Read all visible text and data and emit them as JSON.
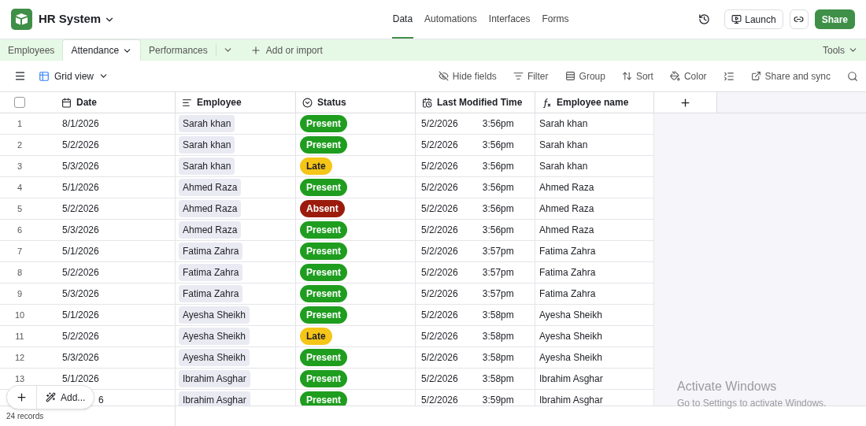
{
  "app": {
    "title": "HR System"
  },
  "nav": [
    {
      "label": "Data",
      "selected": true
    },
    {
      "label": "Automations",
      "selected": false
    },
    {
      "label": "Interfaces",
      "selected": false
    },
    {
      "label": "Forms",
      "selected": false
    }
  ],
  "header_actions": {
    "launch": "Launch",
    "share": "Share"
  },
  "tables": [
    {
      "label": "Employees",
      "selected": false
    },
    {
      "label": "Attendance",
      "selected": true
    },
    {
      "label": "Performances",
      "selected": false
    }
  ],
  "add_table": "Add or import",
  "tools": "Tools",
  "view": {
    "name": "Grid view"
  },
  "toolbar": [
    {
      "kind": "hide",
      "label": "Hide fields"
    },
    {
      "kind": "filter",
      "label": "Filter"
    },
    {
      "kind": "group",
      "label": "Group"
    },
    {
      "kind": "sort",
      "label": "Sort"
    },
    {
      "kind": "color",
      "label": "Color"
    },
    {
      "kind": "height"
    },
    {
      "kind": "share",
      "label": "Share and sync"
    },
    {
      "kind": "search"
    }
  ],
  "select_all": {
    "checked": false
  },
  "columns": [
    {
      "kind": "date",
      "label": "Date"
    },
    {
      "kind": "link",
      "label": "Employee"
    },
    {
      "kind": "status",
      "label": "Status"
    },
    {
      "kind": "modified",
      "label": "Last Modified Time"
    },
    {
      "kind": "formula",
      "label": "Employee name"
    }
  ],
  "rows": [
    {
      "number": "1",
      "date": "8/1/2026",
      "employee": "Sarah khan",
      "status": {
        "label": "Present",
        "color": "#1f9d1f"
      },
      "modified_date": "5/2/2026",
      "modified_time": "3:56pm",
      "employee_name": "Sarah khan"
    },
    {
      "number": "2",
      "date": "5/2/2026",
      "employee": "Sarah khan",
      "status": {
        "label": "Present",
        "color": "#1f9d1f"
      },
      "modified_date": "5/2/2026",
      "modified_time": "3:56pm",
      "employee_name": "Sarah khan"
    },
    {
      "number": "3",
      "date": "5/3/2026",
      "employee": "Sarah khan",
      "status": {
        "label": "Late",
        "color": "#f5c518"
      },
      "modified_date": "5/2/2026",
      "modified_time": "3:56pm",
      "employee_name": "Sarah khan"
    },
    {
      "number": "4",
      "date": "5/1/2026",
      "employee": "Ahmed Raza",
      "status": {
        "label": "Present",
        "color": "#1f9d1f"
      },
      "modified_date": "5/2/2026",
      "modified_time": "3:56pm",
      "employee_name": "Ahmed Raza"
    },
    {
      "number": "5",
      "date": "5/2/2026",
      "employee": "Ahmed Raza",
      "status": {
        "label": "Absent",
        "color": "#9b1c0c"
      },
      "modified_date": "5/2/2026",
      "modified_time": "3:56pm",
      "employee_name": "Ahmed Raza"
    },
    {
      "number": "6",
      "date": "5/3/2026",
      "employee": "Ahmed Raza",
      "status": {
        "label": "Present",
        "color": "#1f9d1f"
      },
      "modified_date": "5/2/2026",
      "modified_time": "3:56pm",
      "employee_name": "Ahmed Raza"
    },
    {
      "number": "7",
      "date": "5/1/2026",
      "employee": "Fatima Zahra",
      "status": {
        "label": "Present",
        "color": "#1f9d1f"
      },
      "modified_date": "5/2/2026",
      "modified_time": "3:57pm",
      "employee_name": "Fatima Zahra"
    },
    {
      "number": "8",
      "date": "5/2/2026",
      "employee": "Fatima Zahra",
      "status": {
        "label": "Present",
        "color": "#1f9d1f"
      },
      "modified_date": "5/2/2026",
      "modified_time": "3:57pm",
      "employee_name": "Fatima Zahra"
    },
    {
      "number": "9",
      "date": "5/3/2026",
      "employee": "Fatima Zahra",
      "status": {
        "label": "Present",
        "color": "#1f9d1f"
      },
      "modified_date": "5/2/2026",
      "modified_time": "3:57pm",
      "employee_name": "Fatima Zahra"
    },
    {
      "number": "10",
      "date": "5/1/2026",
      "employee": "Ayesha Sheikh",
      "status": {
        "label": "Present",
        "color": "#1f9d1f"
      },
      "modified_date": "5/2/2026",
      "modified_time": "3:58pm",
      "employee_name": "Ayesha Sheikh"
    },
    {
      "number": "11",
      "date": "5/2/2026",
      "employee": "Ayesha Sheikh",
      "status": {
        "label": "Late",
        "color": "#f5c518"
      },
      "modified_date": "5/2/2026",
      "modified_time": "3:58pm",
      "employee_name": "Ayesha Sheikh"
    },
    {
      "number": "12",
      "date": "5/3/2026",
      "employee": "Ayesha Sheikh",
      "status": {
        "label": "Present",
        "color": "#1f9d1f"
      },
      "modified_date": "5/2/2026",
      "modified_time": "3:58pm",
      "employee_name": "Ayesha Sheikh"
    },
    {
      "number": "13",
      "date": "5/1/2026",
      "employee": "Ibrahim Asghar",
      "status": {
        "label": "Present",
        "color": "#1f9d1f"
      },
      "modified_date": "5/2/2026",
      "modified_time": "3:58pm",
      "employee_name": "Ibrahim Asghar"
    },
    {
      "date_tail": "6",
      "employee": "Ibrahim Asghar",
      "status": {
        "label": "Present",
        "color": "#1f9d1f"
      },
      "modified_date": "5/2/2026",
      "modified_time": "3:59pm",
      "employee_name": "Ibrahim Asghar"
    }
  ],
  "add_menu": "Add...",
  "record_count": "24 records",
  "os_notice": [
    "Activate Windows",
    "Go to Settings to activate Windows."
  ]
}
